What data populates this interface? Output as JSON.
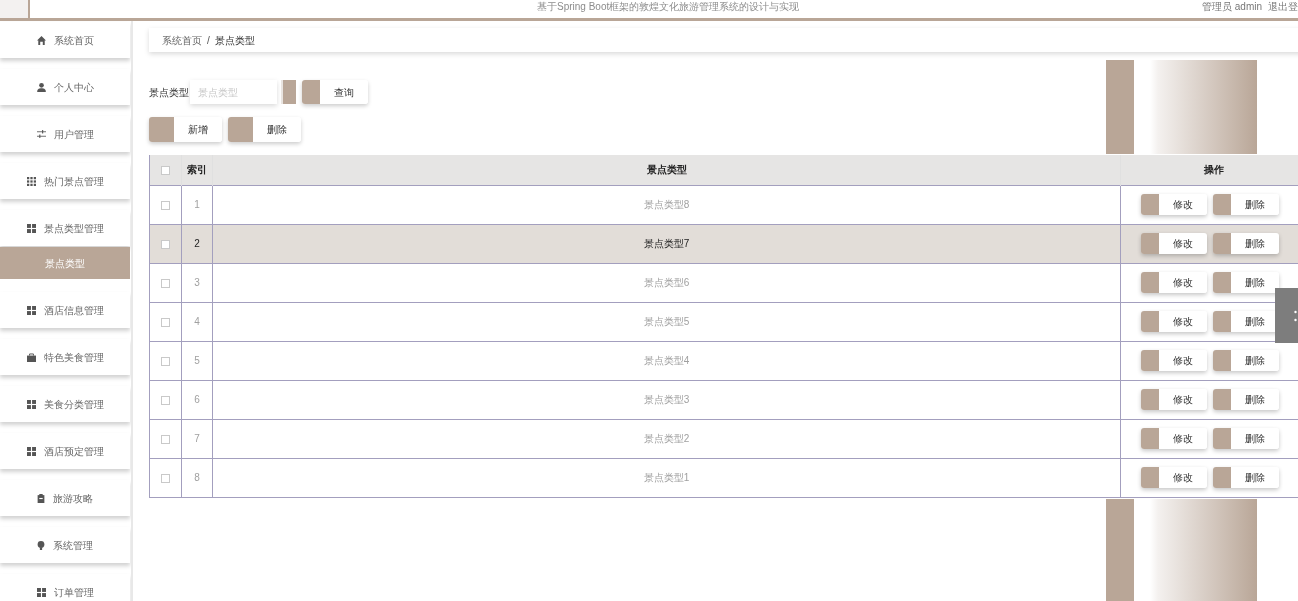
{
  "top_bar": {
    "title": "基于Spring Boot框架的敦煌文化旅游管理系统的设计与实现",
    "user": "管理员 admin",
    "logout": "退出登"
  },
  "sidebar": {
    "items": [
      {
        "label": "系统首页",
        "selected": false
      },
      {
        "label": "个人中心",
        "selected": false
      },
      {
        "label": "用户管理",
        "selected": false
      },
      {
        "label": "热门景点管理",
        "selected": false
      },
      {
        "label": "景点类型管理",
        "selected": false,
        "children": [
          {
            "label": "景点类型",
            "selected": true
          }
        ]
      },
      {
        "label": "酒店信息管理",
        "selected": false
      },
      {
        "label": "特色美食管理",
        "selected": false
      },
      {
        "label": "美食分类管理",
        "selected": false
      },
      {
        "label": "酒店预定管理",
        "selected": false
      },
      {
        "label": "旅游攻略",
        "selected": false
      },
      {
        "label": "系统管理",
        "selected": false
      },
      {
        "label": "订单管理",
        "selected": false
      }
    ]
  },
  "breadcrumb": {
    "items": [
      "系统首页",
      "景点类型"
    ],
    "separator": "/"
  },
  "search": {
    "label": "景点类型",
    "placeholder": "景点类型",
    "button": "查询"
  },
  "toolbar": {
    "buttons": [
      "新增",
      "删除"
    ]
  },
  "table": {
    "columns": [
      "索引",
      "景点类型",
      "操作"
    ],
    "header_checkbox": {
      "checked": false
    },
    "rows": [
      {
        "index": "1",
        "name": "景点类型8",
        "checked": false,
        "selected": false,
        "actions": [
          "修改",
          "删除"
        ]
      },
      {
        "index": "2",
        "name": "景点类型7",
        "checked": false,
        "selected": true,
        "actions": [
          "修改",
          "删除"
        ]
      },
      {
        "index": "3",
        "name": "景点类型6",
        "checked": false,
        "selected": false,
        "actions": [
          "修改",
          "删除"
        ]
      },
      {
        "index": "4",
        "name": "景点类型5",
        "checked": false,
        "selected": false,
        "actions": [
          "修改",
          "删除"
        ]
      },
      {
        "index": "5",
        "name": "景点类型4",
        "checked": false,
        "selected": false,
        "actions": [
          "修改",
          "删除"
        ]
      },
      {
        "index": "6",
        "name": "景点类型3",
        "checked": false,
        "selected": false,
        "actions": [
          "修改",
          "删除"
        ]
      },
      {
        "index": "7",
        "name": "景点类型2",
        "checked": false,
        "selected": false,
        "actions": [
          "修改",
          "删除"
        ]
      },
      {
        "index": "8",
        "name": "景点类型1",
        "checked": false,
        "selected": false,
        "actions": [
          "修改",
          "删除"
        ]
      }
    ]
  }
}
